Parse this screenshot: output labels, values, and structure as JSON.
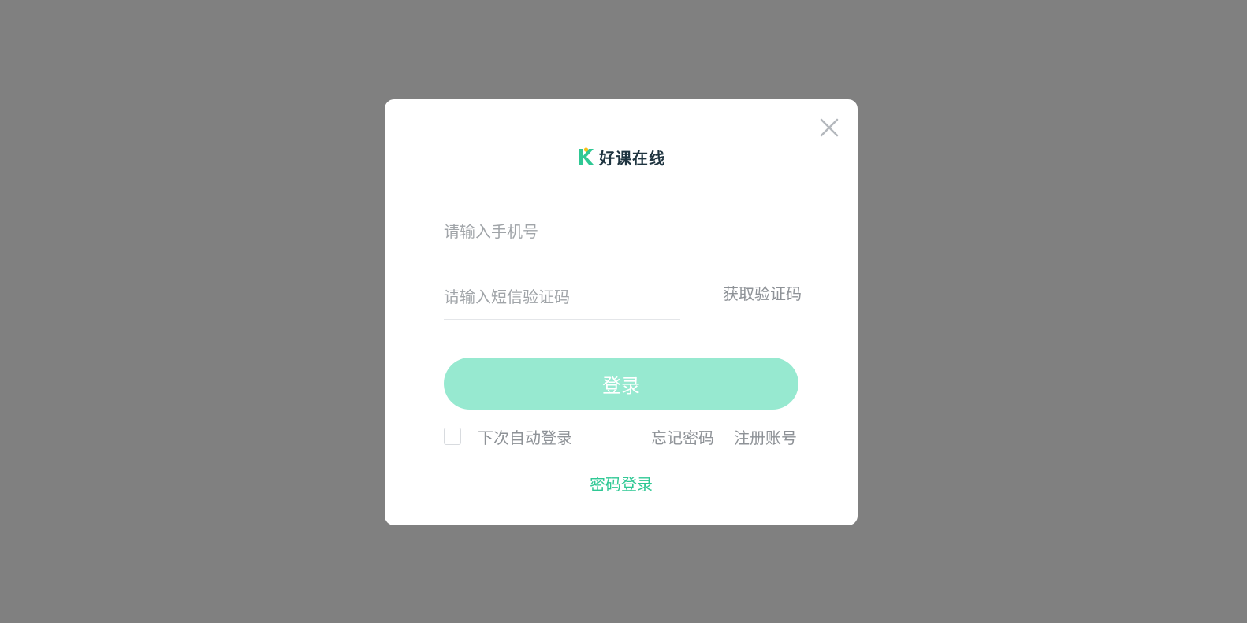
{
  "dialog": {
    "logo_text": "好课在线",
    "phone_placeholder": "请输入手机号",
    "sms_placeholder": "请输入短信验证码",
    "get_code_label": "获取验证码",
    "login_button_label": "登录",
    "remember_label": "下次自动登录",
    "remember_checked": false,
    "forgot_password_label": "忘记密码",
    "register_label": "注册账号",
    "password_login_label": "密码登录"
  },
  "colors": {
    "overlay": "#808080",
    "accent": "#2fc894",
    "login_button_bg": "#97e9d0",
    "text_muted": "#8e9297",
    "logo_text": "#1f3440"
  },
  "icons": {
    "close": "close-icon",
    "logo": "k-logo-icon"
  }
}
